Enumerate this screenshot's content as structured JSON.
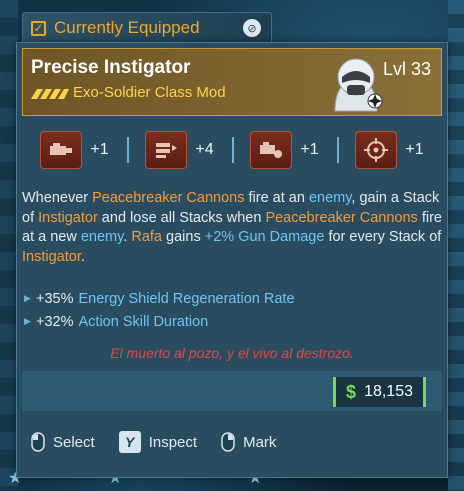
{
  "equipped_tab": {
    "label": "Currently Equipped"
  },
  "item": {
    "name": "Precise Instigator",
    "type": "Exo-Soldier Class Mod",
    "level": "Lvl 33",
    "rarity_icon": "rarity-chevrons-icon",
    "class_icon": "exo-soldier-portrait-icon"
  },
  "skills": [
    {
      "icon": "cannon-skill-icon",
      "bonus": "+1"
    },
    {
      "icon": "barrage-skill-icon",
      "bonus": "+4"
    },
    {
      "icon": "cannon-boost-skill-icon",
      "bonus": "+1"
    },
    {
      "icon": "crosshair-skill-icon",
      "bonus": "+1"
    }
  ],
  "description": {
    "t1": "Whenever ",
    "h1": "Peacebreaker Cannons",
    "t2": " fire at an ",
    "h2": "enemy",
    "t3": ", gain a Stack of ",
    "h3": "Instigator",
    "t4": " and lose all Stacks when ",
    "h4": "Peacebreaker Cannons",
    "t5": " fire at a new ",
    "h5": "enemy",
    "t6": ". ",
    "h6": "Rafa",
    "t7": " gains ",
    "b1": "+2% Gun Damage",
    "t8": " for every Stack of ",
    "h7": "Instigator",
    "t9": "."
  },
  "stats": [
    {
      "value": "+35%",
      "name": "Energy Shield Regeneration Rate"
    },
    {
      "value": "+32%",
      "name": "Action Skill Duration"
    }
  ],
  "flavor_text": "El muerto al pozo, y el vivo al destrozo.",
  "price": {
    "currency_symbol": "$",
    "value": "18,153"
  },
  "actions": [
    {
      "input": "left-mouse-icon",
      "label": "Select"
    },
    {
      "input": "Y",
      "label": "Inspect"
    },
    {
      "input": "right-mouse-icon",
      "label": "Mark"
    }
  ],
  "colors": {
    "accent_orange": "#f59b3a",
    "accent_blue": "#6fc4f0",
    "flavor_red": "#e54545",
    "money_green": "#7ad94a",
    "header_gold": "#c79a3b"
  }
}
